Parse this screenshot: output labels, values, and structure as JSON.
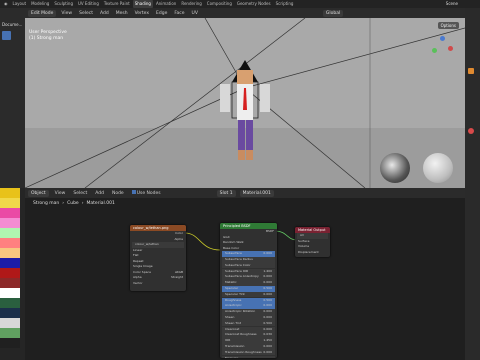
{
  "topbar": {
    "workspaces": [
      "Layout",
      "Modeling",
      "Sculpting",
      "UV Editing",
      "Texture Paint",
      "Shading",
      "Animation",
      "Rendering",
      "Compositing",
      "Geometry Nodes",
      "Scripting"
    ],
    "active": "Shading",
    "scene": "Scene"
  },
  "viewport_header": {
    "mode": "Edit Mode",
    "menus": [
      "View",
      "Select",
      "Add",
      "Mesh",
      "Vertex",
      "Edge",
      "Face",
      "UV"
    ],
    "orientation": "Global"
  },
  "viewport": {
    "line1": "User Perspective",
    "line2": "(1) Strong man",
    "options": "Options"
  },
  "left_panel_label": "Docume...",
  "node_header": {
    "type": "Object",
    "menus": [
      "View",
      "Select",
      "Add",
      "Node"
    ],
    "use_nodes": "Use Nodes",
    "slot": "Slot 1",
    "material": "Material.001"
  },
  "breadcrumb": [
    "Strong man",
    "Cube",
    "Material.001"
  ],
  "image_node": {
    "title": "colour_w/lethan.png",
    "outputs": [
      "Color",
      "Alpha"
    ],
    "image": "colour_w/lethan",
    "rows": [
      "Linear",
      "Flat",
      "Repeat",
      "Single Image",
      "Color Space",
      "Alpha",
      "Vector"
    ],
    "values": [
      "",
      "",
      "",
      "",
      "sRGB",
      "Straight",
      ""
    ]
  },
  "bsdf_node": {
    "title": "Principled BSDF",
    "output": "BSDF",
    "rows": [
      "GGX",
      "Random Walk",
      "Base Color",
      "Subsurface",
      "Subsurface Radius",
      "Subsurface Color",
      "Subsurface IOR",
      "Subsurface Anisotropy",
      "Metallic",
      "Specular",
      "Specular Tint",
      "Roughness",
      "Anisotropic",
      "Anisotropic Rotation",
      "Sheen",
      "Sheen Tint",
      "Clearcoat",
      "Clearcoat Roughness",
      "IOR",
      "Transmission",
      "Transmission Roughness",
      "Emission",
      "Emission Strength",
      "Alpha"
    ],
    "values": [
      "",
      "",
      "",
      "0.000",
      "",
      "",
      "1.400",
      "0.000",
      "0.000",
      "0.500",
      "0.000",
      "0.500",
      "0.000",
      "0.000",
      "0.000",
      "0.500",
      "0.000",
      "0.030",
      "1.450",
      "0.000",
      "0.000",
      "",
      "1.000",
      "1.000"
    ]
  },
  "output_node": {
    "title": "Material Output",
    "target": "All",
    "inputs": [
      "Surface",
      "Volume",
      "Displacement"
    ]
  },
  "colors": {
    "active_tab": "#3d3d3d",
    "image_header": "#8b4a24",
    "bsdf_header": "#2f7a35",
    "output_header": "#7a2232",
    "socket_yellow": "#c7c729",
    "socket_grey": "#a1a1a1",
    "socket_purple": "#6363c7",
    "socket_green": "#63c763",
    "field_blue": "#4772b3"
  },
  "swatches": [
    "#e8c21a",
    "#f0d84a",
    "#ea4aa5",
    "#f48cd2",
    "#b0f5b0",
    "#ff8080",
    "#f7c780",
    "#1c1ca8",
    "#b01818",
    "#8c2828",
    "#ffffff",
    "#2a5f3f",
    "#1b2f4a",
    "#d8d8d8",
    "#60a060",
    "#202020"
  ]
}
